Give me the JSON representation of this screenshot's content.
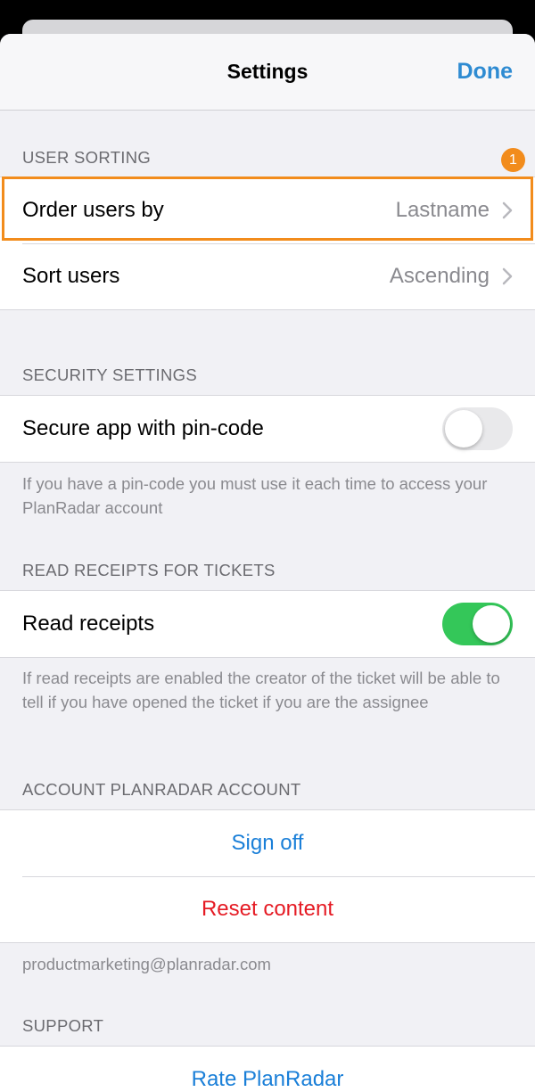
{
  "header": {
    "title": "Settings",
    "done_label": "Done"
  },
  "user_sorting": {
    "header": "USER SORTING",
    "badge": "1",
    "order_users_by": {
      "label": "Order users by",
      "value": "Lastname"
    },
    "sort_users": {
      "label": "Sort users",
      "value": "Ascending"
    }
  },
  "security": {
    "header": "SECURITY SETTINGS",
    "pin_code": {
      "label": "Secure app with pin-code",
      "enabled": false
    },
    "footer": "If you have a pin-code you must use it each time to access your PlanRadar account"
  },
  "read_receipts": {
    "header": "READ RECEIPTS FOR TICKETS",
    "toggle": {
      "label": "Read receipts",
      "enabled": true
    },
    "footer": "If read receipts are enabled the creator of the ticket will be able to tell if you have opened the ticket if you are the assignee"
  },
  "account": {
    "header": "ACCOUNT PLANRADAR ACCOUNT",
    "sign_off": "Sign off",
    "reset_content": "Reset content",
    "email": "productmarketing@planradar.com"
  },
  "support": {
    "header": "SUPPORT",
    "rate": "Rate PlanRadar"
  },
  "colors": {
    "accent": "#2e8bd2",
    "destructive": "#e51b24",
    "toggle_on": "#34c759",
    "highlight": "#f28c1c"
  }
}
